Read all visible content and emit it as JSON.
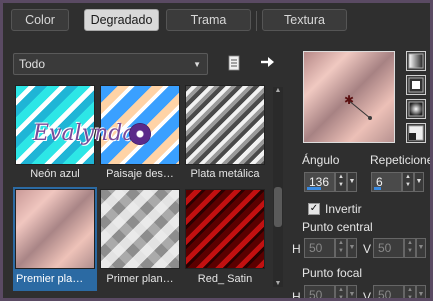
{
  "tabs": [
    {
      "label": "Color",
      "active": false
    },
    {
      "label": "Degradado",
      "active": true
    },
    {
      "label": "Trama",
      "active": false
    },
    {
      "label": "Textura",
      "active": false
    }
  ],
  "filter": {
    "selected": "Todo"
  },
  "gradients": [
    {
      "label": "Neón azul"
    },
    {
      "label": "Paisaje des…"
    },
    {
      "label": "Plata metálica"
    },
    {
      "label": "Premier pla…",
      "selected": true
    },
    {
      "label": "Primer plan…"
    },
    {
      "label": "Red_ Satin"
    }
  ],
  "watermark_text": "Evalynda",
  "settings": {
    "angle_label": "Ángulo",
    "angle_value": "136",
    "repeats_label": "Repeticione",
    "repeats_value": "6",
    "invert_label": "Invertir",
    "invert_checked": true,
    "center_label": "Punto central",
    "center_h_label": "H",
    "center_h": "50",
    "center_v_label": "V",
    "center_v": "50",
    "focal_label": "Punto focal",
    "focal_h_label": "H",
    "focal_h": "50",
    "focal_v_label": "V",
    "focal_v": "50"
  },
  "colors": {
    "accent": "#2b6aa3",
    "background": "#2f2f2f"
  }
}
